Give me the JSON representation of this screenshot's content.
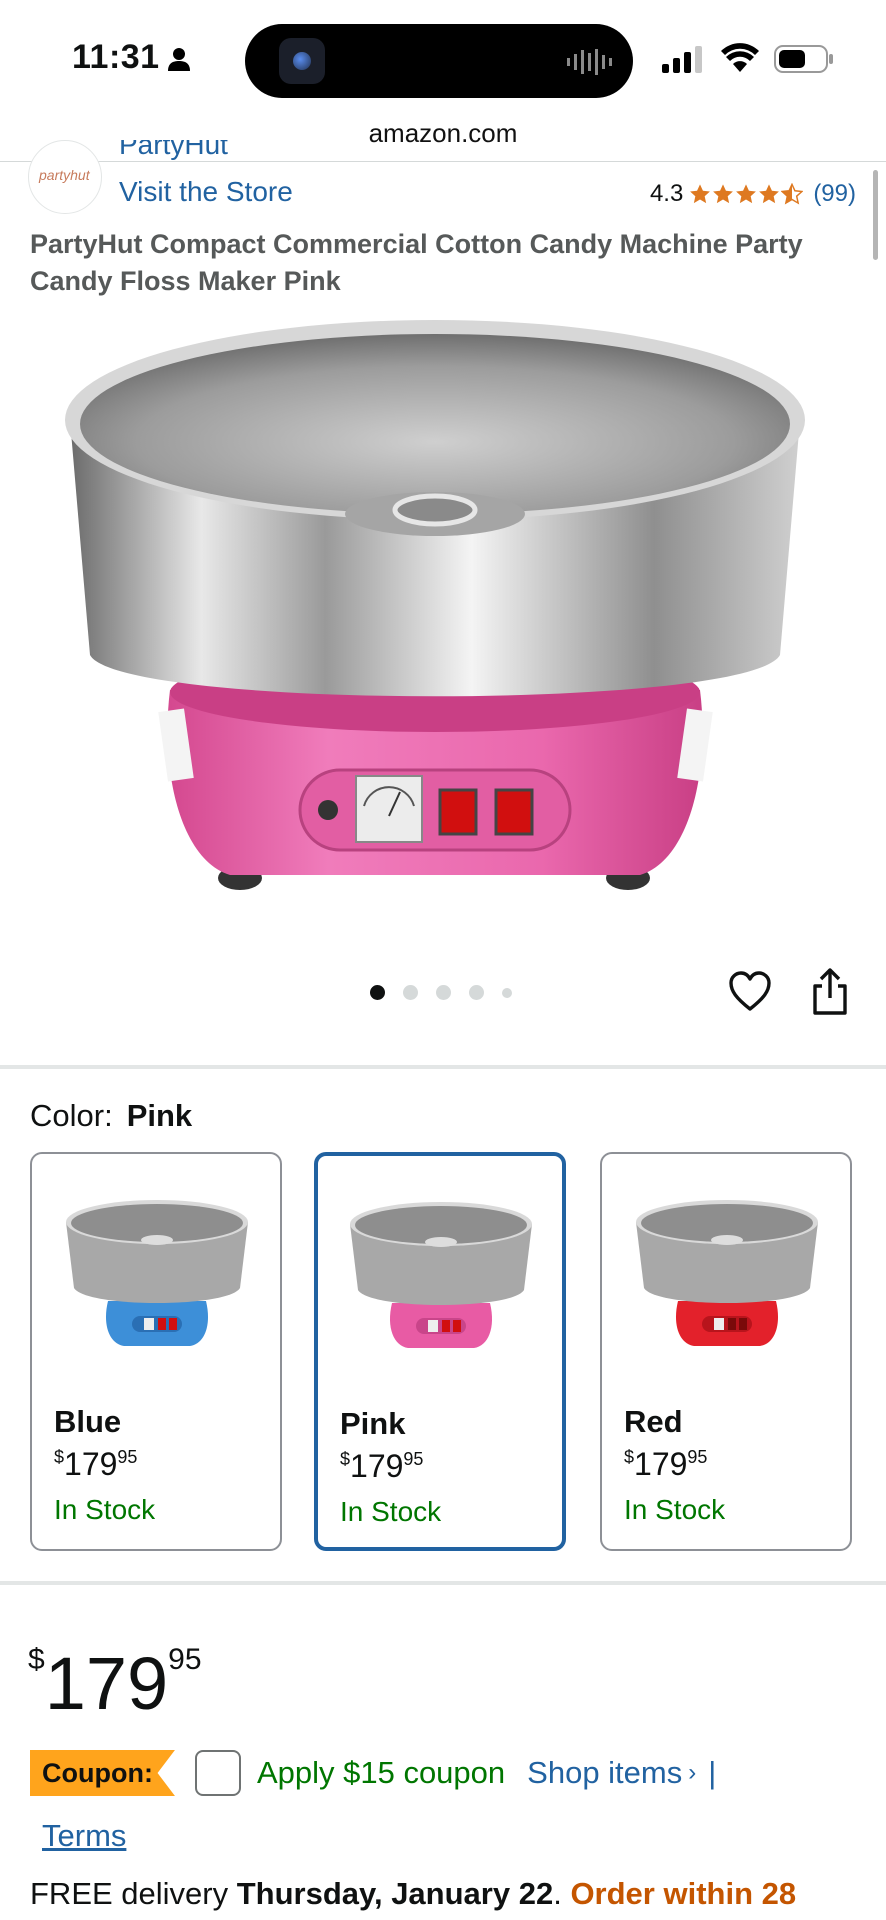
{
  "status_bar": {
    "time": "11:31"
  },
  "browser": {
    "url": "amazon.com"
  },
  "brand": {
    "logo_text": "partyhut",
    "name_partial": "PartyHut",
    "visit_store": "Visit the Store"
  },
  "rating": {
    "value": "4.3",
    "stars": 4.5,
    "count": "(99)"
  },
  "product_title": "PartyHut Compact Commercial Cotton Candy Machine Party Candy Floss Maker Pink",
  "carousel": {
    "total": 5,
    "active": 1
  },
  "color_selector": {
    "label": "Color:",
    "selected": "Pink",
    "options": [
      {
        "name": "Blue",
        "currency": "$",
        "whole": "179",
        "fraction": "95",
        "stock": "In Stock",
        "color": "#3d8fd8"
      },
      {
        "name": "Pink",
        "currency": "$",
        "whole": "179",
        "fraction": "95",
        "stock": "In Stock",
        "color": "#e85ba4"
      },
      {
        "name": "Red",
        "currency": "$",
        "whole": "179",
        "fraction": "95",
        "stock": "In Stock",
        "color": "#e3212b"
      }
    ]
  },
  "price": {
    "currency": "$",
    "whole": "179",
    "fraction": "95"
  },
  "coupon": {
    "tag": "Coupon:",
    "text": "Apply $15 coupon",
    "shop_items": "Shop items",
    "chevron": "›",
    "separator": "|",
    "terms": "Terms"
  },
  "delivery": {
    "prefix": "FREE delivery",
    "date": "Thursday, January 22",
    "period": ".",
    "order_within": "Order within 28"
  },
  "colors": {
    "link": "#2162a1",
    "stock": "#007600",
    "coupon": "#ffa41c",
    "star": "#de7921",
    "deadline": "#c45500"
  }
}
